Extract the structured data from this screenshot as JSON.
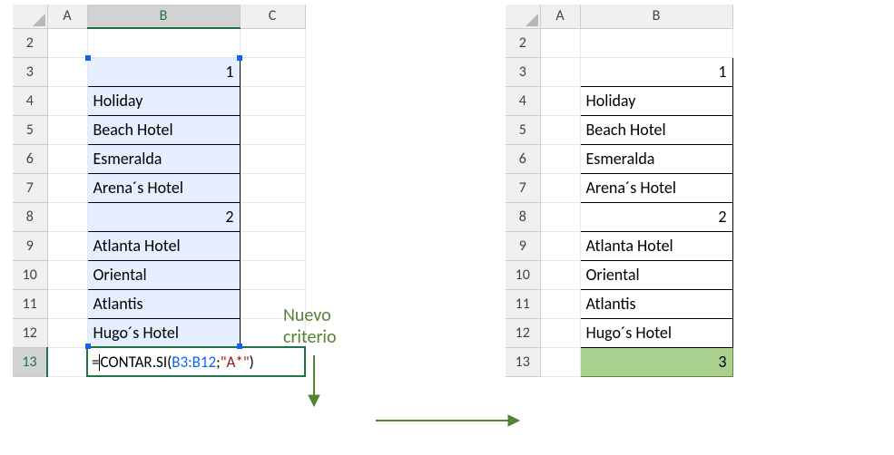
{
  "left": {
    "columns": [
      "A",
      "B",
      "C"
    ],
    "rows": [
      "2",
      "3",
      "4",
      "5",
      "6",
      "7",
      "8",
      "9",
      "10",
      "11",
      "12",
      "13"
    ],
    "data": {
      "B3": "1",
      "B4": "Holiday",
      "B5": "Beach Hotel",
      "B6": "Esmeralda",
      "B7": "Arena´s Hotel",
      "B8": "2",
      "B9": "Atlanta Hotel",
      "B10": "Oriental",
      "B11": "Atlantis",
      "B12": "Hugo´s Hotel"
    },
    "formula": {
      "prefix": "=",
      "fn": "CONTAR.SI(",
      "ref": "B3:B12",
      "sep": ";",
      "str": "\"A*\"",
      "suffix": ")"
    }
  },
  "right": {
    "columns": [
      "A",
      "B"
    ],
    "rows": [
      "2",
      "3",
      "4",
      "5",
      "6",
      "7",
      "8",
      "9",
      "10",
      "11",
      "12",
      "13"
    ],
    "data": {
      "B3": "1",
      "B4": "Holiday",
      "B5": "Beach Hotel",
      "B6": "Esmeralda",
      "B7": "Arena´s Hotel",
      "B8": "2",
      "B9": "Atlanta Hotel",
      "B10": "Oriental",
      "B11": "Atlantis",
      "B12": "Hugo´s Hotel",
      "B13": "3"
    }
  },
  "annotation": {
    "line1": "Nuevo",
    "line2": "criterio"
  },
  "chart_data": null
}
